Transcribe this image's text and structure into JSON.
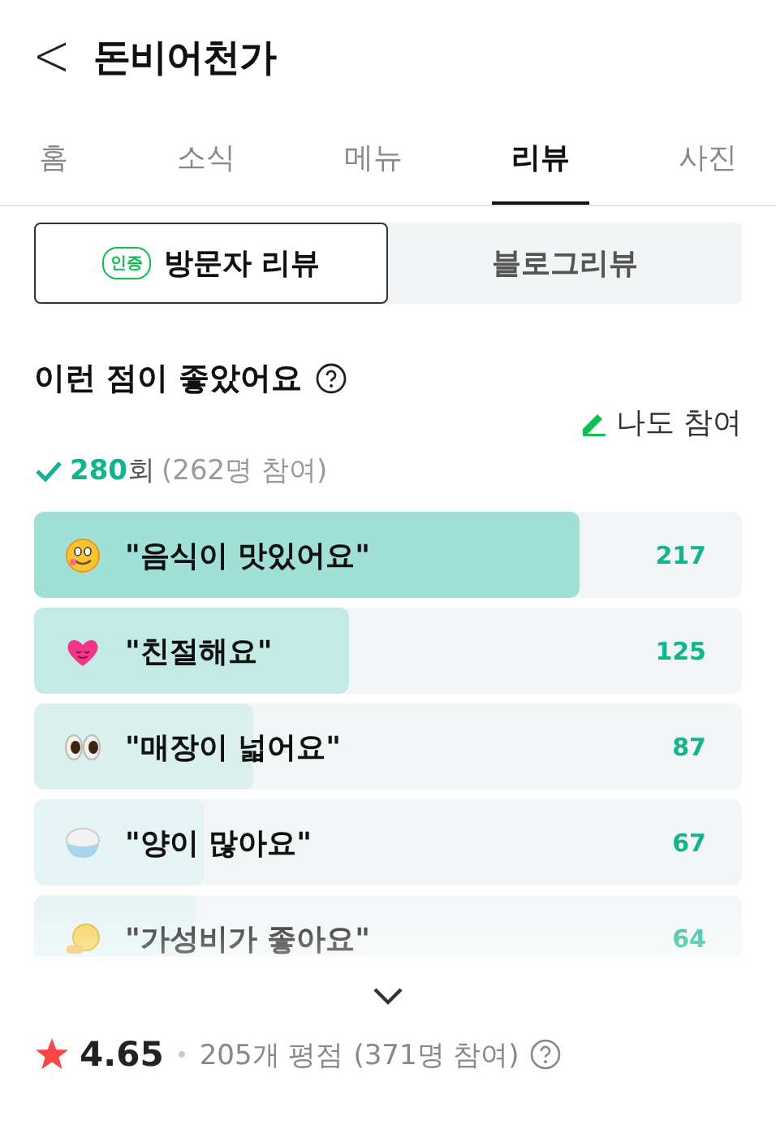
{
  "header": {
    "back_icon": "<",
    "title": "돈비어천가"
  },
  "tabs": [
    {
      "label": "홈",
      "selected": false
    },
    {
      "label": "소식",
      "selected": false
    },
    {
      "label": "메뉴",
      "selected": false
    },
    {
      "label": "리뷰",
      "selected": true
    },
    {
      "label": "사진",
      "selected": false
    }
  ],
  "review_types": [
    {
      "label": "방문자 리뷰",
      "badge": "인증",
      "selected": true
    },
    {
      "label": "블로그리뷰",
      "selected": false
    }
  ],
  "keywords": {
    "title": "이런 점이 좋았어요",
    "join_link": "나도 참여",
    "count": "280",
    "count_unit": "회",
    "participants": "(262명 참여)",
    "items": [
      {
        "kind": "smile",
        "label": "\"음식이 맛있어요\"",
        "count": "217",
        "level": 0.77,
        "color": "#a1e0d6"
      },
      {
        "kind": "heart",
        "label": "\"친절해요\"",
        "count": "125",
        "level": 0.445,
        "color": "#c3eae4"
      },
      {
        "kind": "eyes",
        "label": "\"매장이 넓어요\"",
        "count": "87",
        "level": 0.31,
        "color": "#d9f0ed"
      },
      {
        "kind": "rice",
        "label": "\"양이 많아요\"",
        "count": "67",
        "level": 0.24,
        "color": "#e4f3f3"
      },
      {
        "kind": "coin",
        "label": "\"가성비가 좋아요\"",
        "count": "64",
        "level": 0.23,
        "color": "#e4f3f3"
      }
    ]
  },
  "rating": {
    "score": "4.65",
    "reviews": "205개 평점",
    "participants": "(371명 참여)"
  }
}
